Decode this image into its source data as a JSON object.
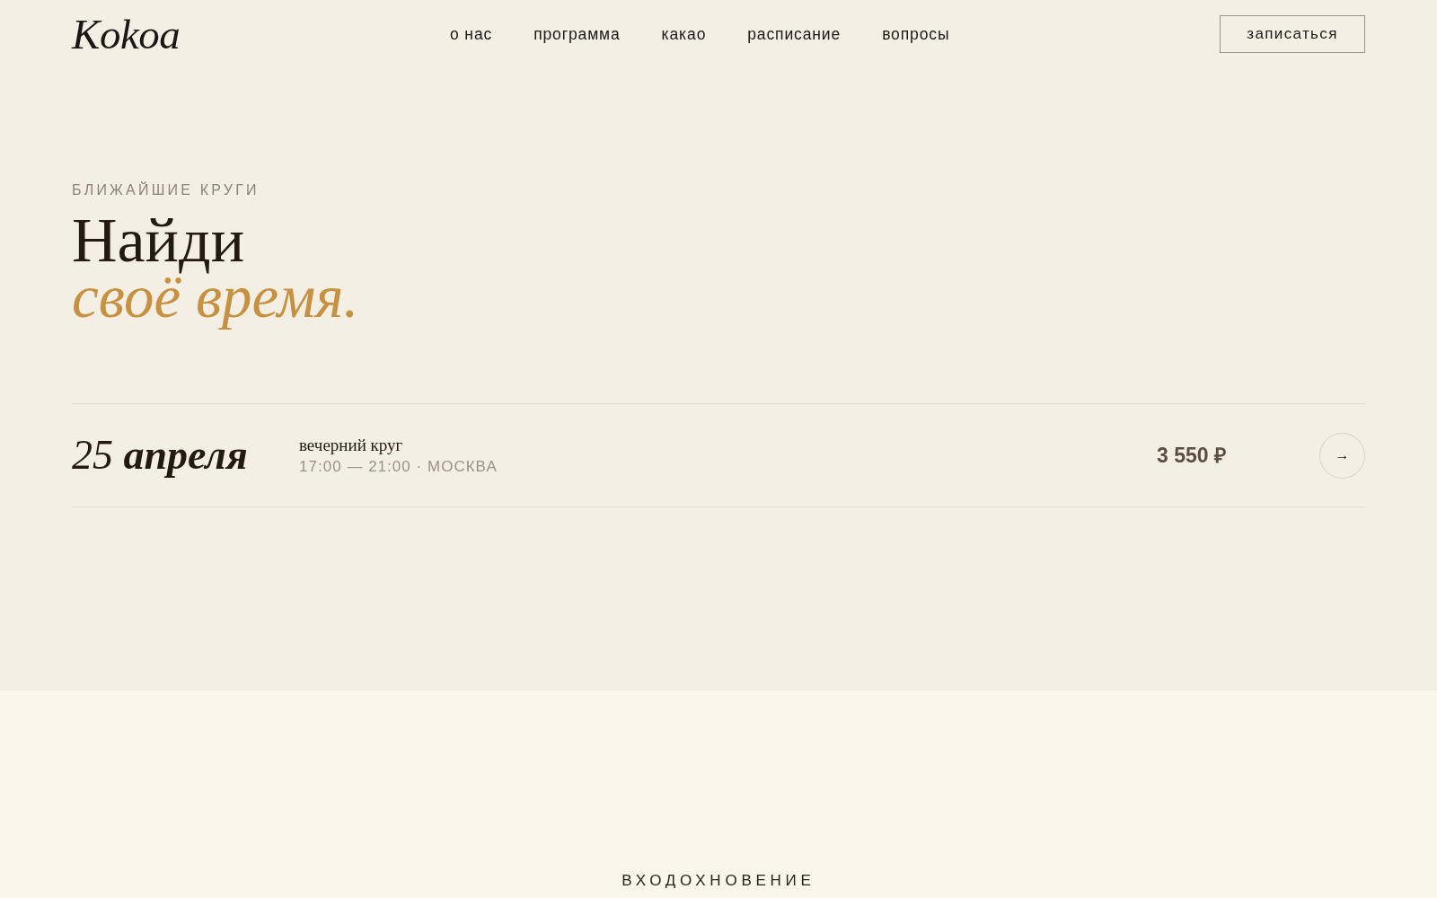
{
  "header": {
    "logo": "Kokoa",
    "nav": [
      "о нас",
      "программа",
      "какао",
      "расписание",
      "вопросы"
    ],
    "cta": "записаться"
  },
  "hero": {
    "eyebrow": "БЛИЖАЙШИЕ КРУГИ",
    "title": "Найди",
    "title_accent": "своё время."
  },
  "sessions": [
    {
      "date": "25 **апреля**",
      "title": "вечерний круг",
      "details": "17:00 — 21:00 · МОСКВА",
      "price": "3 550 ₽",
      "action": "→"
    }
  ],
  "next_section": {
    "heading": "ВХОДОХНОВЕНИЕ"
  }
}
